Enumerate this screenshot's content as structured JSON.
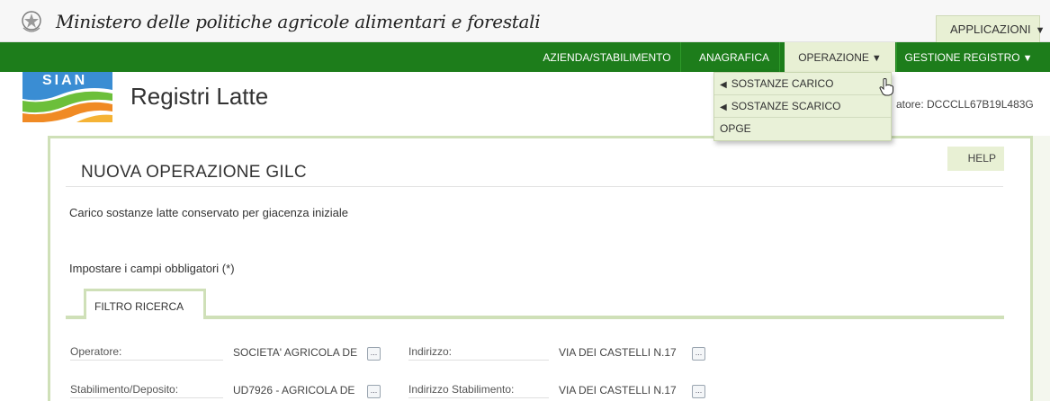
{
  "header": {
    "ministry": "Ministero delle politiche agricole alimentari e forestali",
    "applicazioni": "APPLICAZIONI",
    "arrow": "▼"
  },
  "nav": {
    "items": [
      {
        "label": "AZIENDA/STABILIMENTO"
      },
      {
        "label": "ANAGRAFICA"
      },
      {
        "label": "OPERAZIONE"
      },
      {
        "label": "GESTIONE REGISTRO"
      }
    ]
  },
  "logo": {
    "text": "SIAN"
  },
  "app": {
    "title": "Registri Latte",
    "user_info": "atore: DCCCLL67B19L483G"
  },
  "dropdown": {
    "items": [
      {
        "label": "SOSTANZE CARICO",
        "marker": "◀"
      },
      {
        "label": "SOSTANZE SCARICO",
        "marker": "◀"
      },
      {
        "label": "OPGE"
      }
    ]
  },
  "page": {
    "help": "HELP",
    "title": "NUOVA OPERAZIONE GILC",
    "subtitle": "Carico sostanze latte conservato per giacenza iniziale",
    "required": "Impostare i campi obbligatori (*)",
    "tab": "FILTRO RICERCA",
    "dots": "..."
  },
  "form": {
    "operatore_label": "Operatore:",
    "operatore_value": "SOCIETA' AGRICOLA DE",
    "indirizzo_label": "Indirizzo:",
    "indirizzo_value": "VIA DEI CASTELLI N.17",
    "stabilimento_label": "Stabilimento/Deposito:",
    "stabilimento_value": "UD7926 - AGRICOLA DE",
    "ind_stab_label": "Indirizzo Stabilimento:",
    "ind_stab_value": "VIA DEI CASTELLI N.17"
  },
  "colors": {
    "nav_green": "#1d7d1b",
    "light_green": "#e8f0d4",
    "panel_border": "#cfe0b8"
  }
}
